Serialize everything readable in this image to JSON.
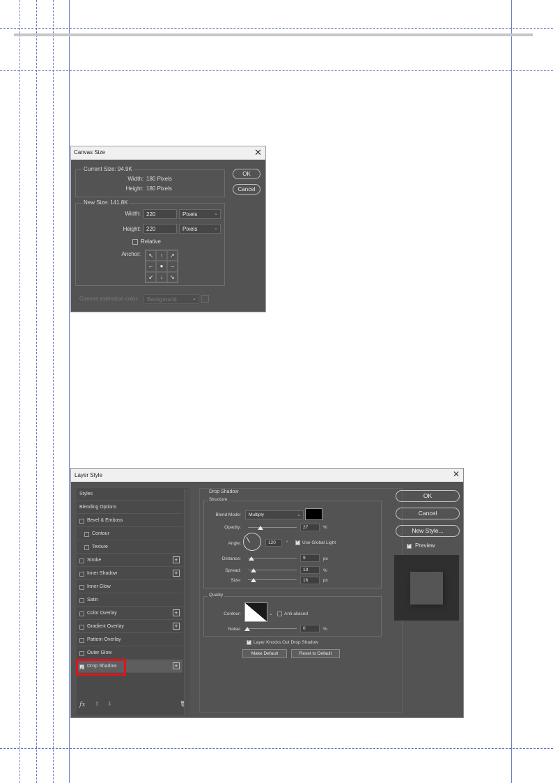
{
  "canvas_size": {
    "title": "Canvas Size",
    "current_size_label": "Current Size: 94.9K",
    "current_width_label": "Width:",
    "current_width_value": "180 Pixels",
    "current_height_label": "Height:",
    "current_height_value": "180 Pixels",
    "new_size_label": "New Size: 141.8K",
    "width_label": "Width:",
    "width_value": "220",
    "width_unit": "Pixels",
    "height_label": "Height:",
    "height_value": "220",
    "height_unit": "Pixels",
    "relative_label": "Relative",
    "anchor_label": "Anchor:",
    "ext_color_label": "Canvas extension color:",
    "ext_color_value": "Background",
    "ok_label": "OK",
    "cancel_label": "Cancel"
  },
  "layer_style": {
    "title": "Layer Style",
    "left_items": [
      {
        "label": "Styles"
      },
      {
        "label": "Blending Options"
      },
      {
        "label": "Bevel & Emboss"
      },
      {
        "label": "Contour"
      },
      {
        "label": "Texture"
      },
      {
        "label": "Stroke"
      },
      {
        "label": "Inner Shadow"
      },
      {
        "label": "Inner Glow"
      },
      {
        "label": "Satin"
      },
      {
        "label": "Color Overlay"
      },
      {
        "label": "Gradient Overlay"
      },
      {
        "label": "Pattern Overlay"
      },
      {
        "label": "Outer Glow"
      },
      {
        "label": "Drop Shadow"
      }
    ],
    "fx_label": "fx",
    "section_title": "Drop Shadow",
    "structure_label": "Structure",
    "blend_mode_label": "Blend Mode:",
    "blend_mode_value": "Multiply",
    "shadow_color": "#000000",
    "opacity_label": "Opacity:",
    "opacity_value": "27",
    "angle_label": "Angle:",
    "angle_value": "120",
    "use_global_light_label": "Use Global Light",
    "distance_label": "Distance:",
    "distance_value": "9",
    "spread_label": "Spread:",
    "spread_value": "19",
    "size_label": "Size:",
    "size_value": "16",
    "percent_unit": "%",
    "px_unit": "px",
    "degree_unit": "°",
    "quality_label": "Quality",
    "contour_label": "Contour:",
    "anti_aliased_label": "Anti-aliased",
    "noise_label": "Noise:",
    "noise_value": "0",
    "knocks_out_label": "Layer Knocks Out Drop Shadow",
    "make_default_label": "Make Default",
    "reset_default_label": "Reset to Default",
    "ok_label": "OK",
    "cancel_label": "Cancel",
    "new_style_label": "New Style...",
    "preview_label": "Preview"
  },
  "colors": {
    "dialog_bg": "#535353",
    "highlight_red": "#e0131b",
    "guide_blue": "#6a7fc4"
  }
}
